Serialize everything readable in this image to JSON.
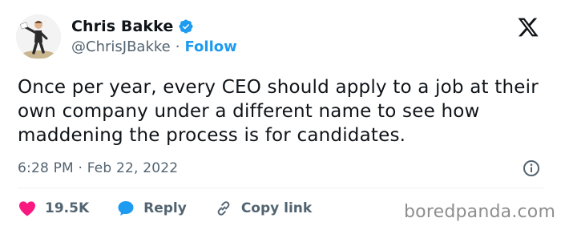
{
  "author": {
    "display_name": "Chris Bakke",
    "handle": "@ChrisJBakke",
    "separator": "·",
    "follow_label": "Follow"
  },
  "tweet": {
    "text": "Once per year, every CEO should apply to a job at their own company under a different name to see how maddening the process is for candidates.",
    "timestamp": "6:28 PM · Feb 22, 2022"
  },
  "actions": {
    "likes": "19.5K",
    "reply_label": "Reply",
    "copy_link_label": "Copy link"
  },
  "watermark": "boredpanda.com",
  "colors": {
    "text": "#0f1419",
    "secondary": "#536471",
    "accent_blue": "#1d9bf0",
    "like_pink": "#f91880",
    "divider": "#eff3f4"
  },
  "icons": {
    "logo": "x-logo-icon",
    "verified": "verified-badge-icon",
    "info": "info-icon",
    "like": "heart-icon",
    "reply": "reply-bubble-icon",
    "copy_link": "link-icon"
  }
}
